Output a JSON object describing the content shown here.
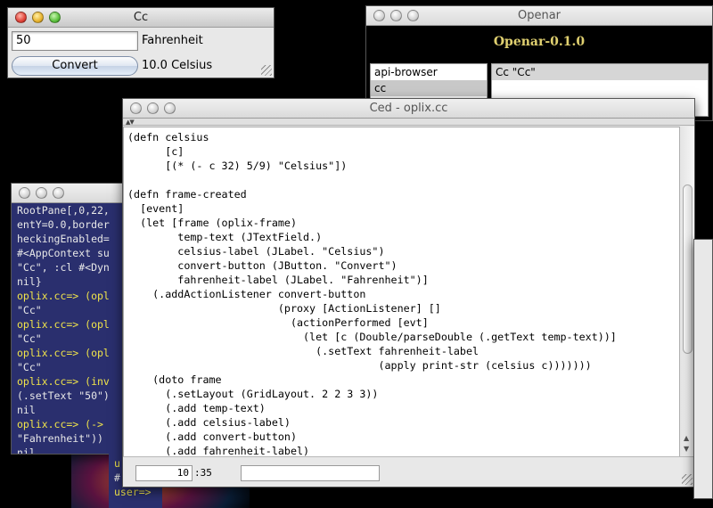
{
  "console": {
    "lines": [
      {
        "text": "RootPane[,0,22,",
        "kind": "out"
      },
      {
        "text": "entY=0.0,border",
        "kind": "out"
      },
      {
        "text": "heckingEnabled=",
        "kind": "out"
      },
      {
        "text": "#<AppContext su",
        "kind": "out"
      },
      {
        "text": "\"Cc\", :cl #<Dyn",
        "kind": "out"
      },
      {
        "text": "nil}",
        "kind": "out"
      },
      {
        "text": "oplix.cc=> (opl",
        "kind": "prompt"
      },
      {
        "text": "\"Cc\"",
        "kind": "out"
      },
      {
        "text": "oplix.cc=> (opl",
        "kind": "prompt"
      },
      {
        "text": "\"Cc\"",
        "kind": "out"
      },
      {
        "text": "oplix.cc=> (opl",
        "kind": "prompt"
      },
      {
        "text": "\"Cc\"",
        "kind": "out"
      },
      {
        "text": "oplix.cc=> (inv",
        "kind": "prompt"
      },
      {
        "text": "(.setText \"50\")",
        "kind": "out"
      },
      {
        "text": "nil",
        "kind": "out"
      },
      {
        "text": "oplix.cc=> (->",
        "kind": "prompt"
      },
      {
        "text": "\"Fahrenheit\"))",
        "kind": "out"
      },
      {
        "text": "nil",
        "kind": "out"
      },
      {
        "text": "oplix.cc=>",
        "kind": "prompt"
      }
    ],
    "second_lines": [
      "u",
      "#",
      "user=>"
    ]
  },
  "openar": {
    "title": "Openar",
    "heading": "Openar-0.1.0",
    "list": [
      "api-browser",
      "cc"
    ],
    "selected_index": 1,
    "detail": "Cc \"Cc\""
  },
  "cc": {
    "title": "Cc",
    "input_value": "50",
    "input_label": "Fahrenheit",
    "button_label": "Convert",
    "result": "10.0 Celsius"
  },
  "ced": {
    "title": "Ced - oplix.cc",
    "code": "(defn celsius\n      [c]\n      [(* (- c 32) 5/9) \"Celsius\"])\n\n(defn frame-created\n  [event]\n  (let [frame (oplix-frame)\n        temp-text (JTextField.)\n        celsius-label (JLabel. \"Celsius\")\n        convert-button (JButton. \"Convert\")\n        fahrenheit-label (JLabel. \"Fahrenheit\")]\n    (.addActionListener convert-button\n                        (proxy [ActionListener] []\n                          (actionPerformed [evt]\n                            (let [c (Double/parseDouble (.getText temp-text))]\n                              (.setText fahrenheit-label\n                                        (apply print-str (celsius c)))))))\n    (doto frame\n      (.setLayout (GridLayout. 2 2 3 3))\n      (.add temp-text)\n      (.add celsius-label)\n      (.add convert-button)\n      (.add fahrenheit-label)",
    "status": {
      "position": "10",
      "column": ":35",
      "message": ""
    }
  }
}
